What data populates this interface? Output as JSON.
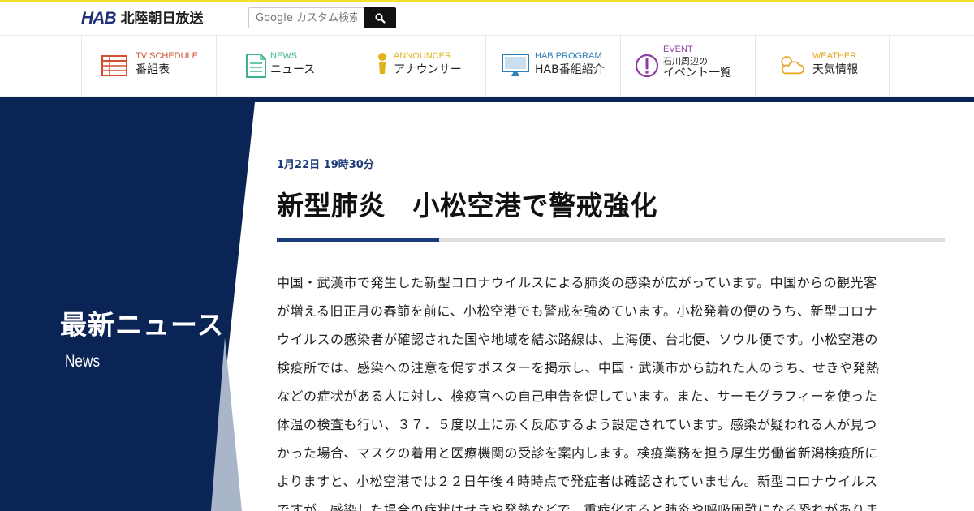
{
  "header": {
    "logo_mark": "HAB",
    "logo_name": "北陸朝日放送",
    "search": {
      "placeholder": "Google カスタム検索"
    }
  },
  "nav": [
    {
      "en": "TV SCHEDULE",
      "ja": "番組表",
      "icon": "tv-schedule-icon",
      "color": "#d2502f"
    },
    {
      "en": "NEWS",
      "ja": "ニュース",
      "icon": "news-icon",
      "color": "#3fb394"
    },
    {
      "en": "ANNOUNCER",
      "ja": "アナウンサー",
      "icon": "announcer-icon",
      "color": "#e0b21b"
    },
    {
      "en": "HAB PROGRAM",
      "ja": "HAB番組紹介",
      "icon": "monitor-icon",
      "color": "#2c7fb8"
    },
    {
      "en": "EVENT",
      "ja_line1": "石川周辺の",
      "ja_line2": "イベント一覧",
      "icon": "exclamation-icon",
      "color": "#8e3ea0"
    },
    {
      "en": "WEATHER",
      "ja": "天気情報",
      "icon": "weather-icon",
      "color": "#e8a41f"
    }
  ],
  "sidebar": {
    "title": "最新ニュース",
    "subtitle": "News"
  },
  "article": {
    "date": "1月22日 19時30分",
    "title": "新型肺炎　小松空港で警戒強化",
    "body_lines": [
      "中国・武漢市で発生した新型コロナウイルスによる肺炎の感染が広がっています。中国からの観光客",
      "が増える旧正月の春節を前に、小松空港でも警戒を強めています。小松発着の便のうち、新型コロナ",
      "ウイルスの感染者が確認された国や地域を結ぶ路線は、上海便、台北便、ソウル便です。小松空港の",
      "検疫所では、感染への注意を促すポスターを掲示し、中国・武漢市から訪れた人のうち、せきや発熱",
      "などの症状がある人に対し、検疫官への自己申告を促しています。また、サーモグラフィーを使った",
      "体温の検査も行い、３７．５度以上に赤く反応するよう設定されています。感染が疑われる人が見つ",
      "かった場合、マスクの着用と医療機関の受診を案内します。検疫業務を担う厚生労働省新潟検疫所に",
      "よりますと、小松空港では２２日午後４時時点で発症者は確認されていません。新型コロナウイルス",
      "ですが、感染した場合の症状はせきや発熱などで、重症化すると肺炎や呼吸困難になる恐れがありま"
    ]
  },
  "colors": {
    "accent_yellow": "#f2e02c",
    "navy": "#0b2456",
    "date_blue": "#1b3c77",
    "sidebar_slope": "#a9b6c9"
  }
}
